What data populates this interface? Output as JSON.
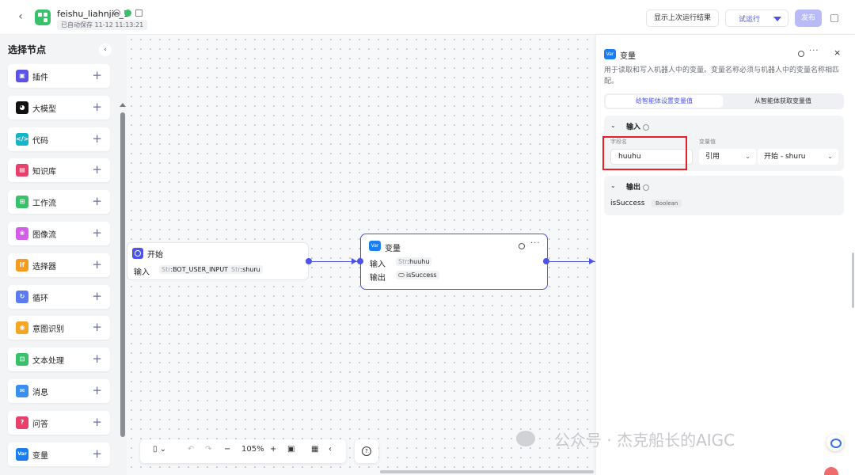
{
  "header": {
    "title": "feishu_liahnjie_1",
    "autosave": "已自动保存 11-12 11:13:21",
    "show_last_run": "显示上次运行结果",
    "trial_run": "试运行",
    "publish": "发布"
  },
  "sidebar": {
    "title": "选择节点",
    "items": [
      {
        "label": "插件",
        "icon": "plugin-icon",
        "color": "#5b52e8"
      },
      {
        "label": "大模型",
        "icon": "llm-icon",
        "color": "#111111"
      },
      {
        "label": "代码",
        "icon": "code-icon",
        "color": "#16b4c9"
      },
      {
        "label": "知识库",
        "icon": "knowledge-icon",
        "color": "#e8406b"
      },
      {
        "label": "工作流",
        "icon": "workflow-icon",
        "color": "#37c26a"
      },
      {
        "label": "图像流",
        "icon": "imageflow-icon",
        "color": "#d25ee8"
      },
      {
        "label": "选择器",
        "icon": "condition-icon",
        "color": "#f59a23"
      },
      {
        "label": "循环",
        "icon": "loop-icon",
        "color": "#5b7cf0"
      },
      {
        "label": "意图识别",
        "icon": "intent-icon",
        "color": "#f5a623"
      },
      {
        "label": "文本处理",
        "icon": "text-process-icon",
        "color": "#37c26a"
      },
      {
        "label": "消息",
        "icon": "message-icon",
        "color": "#3a8ef0"
      },
      {
        "label": "问答",
        "icon": "qa-icon",
        "color": "#e8406b"
      },
      {
        "label": "变量",
        "icon": "variable-icon",
        "color": "#1a7df0"
      }
    ]
  },
  "canvas": {
    "start_node": {
      "title": "开始",
      "input_label": "输入",
      "tags": [
        {
          "prefix": "Str",
          "name": "BOT_USER_INPUT"
        },
        {
          "prefix": "Str",
          "name": "shuru"
        }
      ]
    },
    "var_node": {
      "icon_text": "Var",
      "title": "变量",
      "input_label": "输入",
      "input_tag": {
        "prefix": "Str",
        "name": "huuhu"
      },
      "output_label": "输出",
      "output_tag": "isSuccess"
    },
    "toolbar": {
      "zoom": "105%"
    }
  },
  "panel": {
    "icon_text": "Var",
    "title": "变量",
    "description": "用于读取和写入机器人中的变量。变量名称必须与机器人中的变量名称相匹配。",
    "tab_set": "给智能体设置变量值",
    "tab_get": "从智能体获取变量值",
    "input_section": "输入",
    "field_name_label": "字段名",
    "field_value_label": "变量值",
    "field_name_value": "huuhu",
    "ref_select": "引用",
    "ref_value": "开始 - shuru",
    "output_section": "输出",
    "output_name": "isSuccess",
    "output_type": "Boolean"
  },
  "watermark": "公众号 · 杰克船长的AIGC"
}
